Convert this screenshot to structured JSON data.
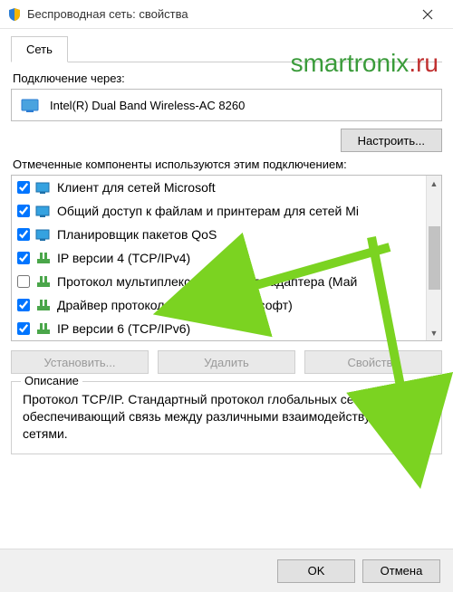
{
  "window": {
    "title": "Беспроводная сеть: свойства"
  },
  "watermark": {
    "part1": "smartronix",
    "part2": ".ru"
  },
  "tab": {
    "network": "Сеть"
  },
  "connect_via_label": "Подключение через:",
  "adapter": {
    "name": "Intel(R) Dual Band Wireless-AC 8260"
  },
  "configure_btn": "Настроить...",
  "components_label": "Отмеченные компоненты используются этим подключением:",
  "components": [
    {
      "checked": true,
      "icon": "net-client",
      "label": "Клиент для сетей Microsoft"
    },
    {
      "checked": true,
      "icon": "net-share",
      "label": "Общий доступ к файлам и принтерам для сетей Mi"
    },
    {
      "checked": true,
      "icon": "net-sched",
      "label": "Планировщик пакетов QoS"
    },
    {
      "checked": true,
      "icon": "net-proto",
      "label": "IP версии 4 (TCP/IPv4)"
    },
    {
      "checked": false,
      "icon": "net-proto",
      "label": "Протокол мультиплексора сетевого адаптера (Май"
    },
    {
      "checked": true,
      "icon": "net-proto",
      "label": "Драйвер протокола LLDP (Майкрософт)"
    },
    {
      "checked": true,
      "icon": "net-proto",
      "label": "IP версии 6 (TCP/IPv6)"
    }
  ],
  "buttons": {
    "install": "Установить...",
    "remove": "Удалить",
    "properties": "Свойства"
  },
  "description": {
    "legend": "Описание",
    "text": "Протокол TCP/IP. Стандартный протокол глобальных сетей, обеспечивающий связь между различными взаимодействующими сетями."
  },
  "footer": {
    "ok": "OK",
    "cancel": "Отмена"
  }
}
